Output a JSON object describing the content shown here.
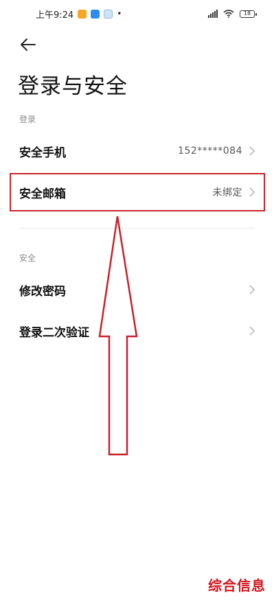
{
  "status_bar": {
    "time": "上午9:24",
    "battery_level": "18",
    "icons": [
      "orange-app-icon",
      "blue-app-icon",
      "lightblue-app-icon",
      "dot-icon",
      "signal-icon",
      "wifi-icon",
      "battery-icon"
    ]
  },
  "header": {
    "back_icon": "arrow-left-icon",
    "title": "登录与安全"
  },
  "sections": {
    "login": {
      "label": "登录",
      "phone": {
        "label": "安全手机",
        "value": "152*****084"
      },
      "email": {
        "label": "安全邮箱",
        "value": "未绑定"
      }
    },
    "security": {
      "label": "安全",
      "password": {
        "label": "修改密码"
      },
      "two_step": {
        "label": "登录二次验证"
      }
    }
  },
  "annotation": {
    "highlight_color": "#c8202a",
    "arrow_color": "#c8202a"
  },
  "watermark": "综合信息"
}
